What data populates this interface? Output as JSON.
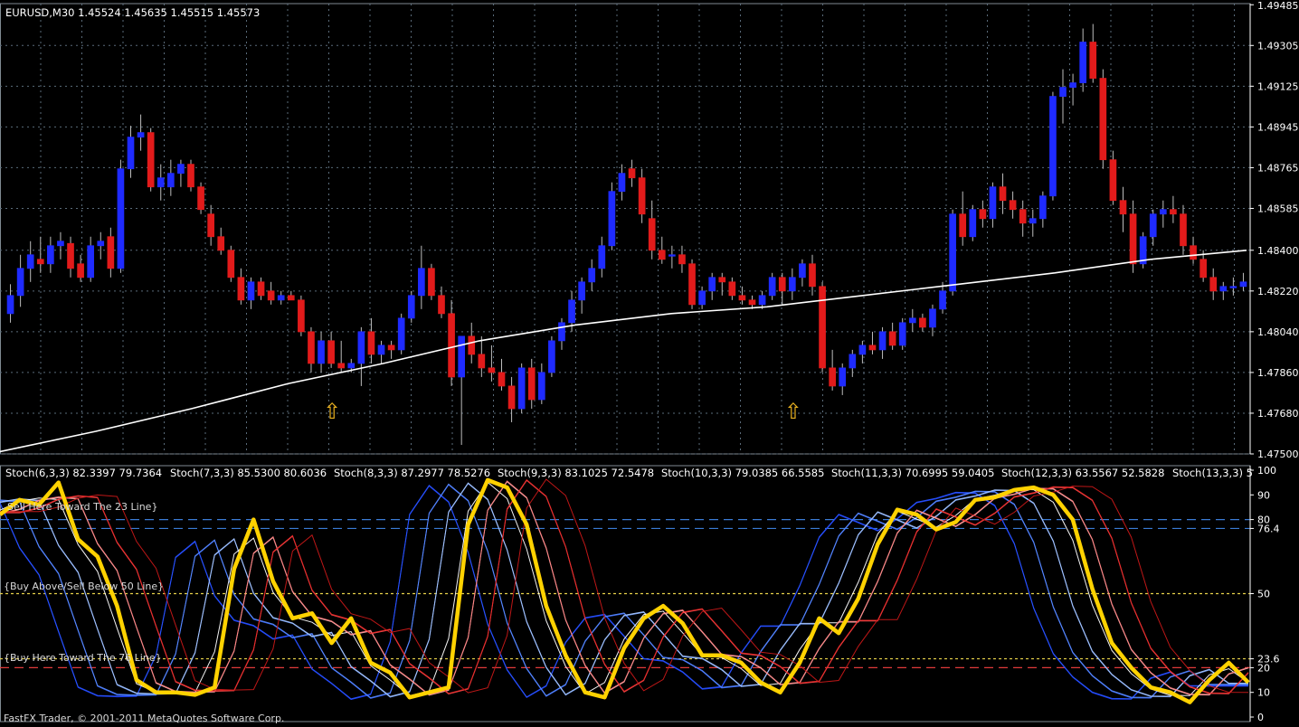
{
  "window": {
    "symbol_info": "EURUSD,M30  1.45524 1.45635 1.45515 1.45573",
    "footer": "FastFX Trader, © 2001-2011 MetaQuotes Software Corp."
  },
  "colors": {
    "background": "#000000",
    "grid": "#5a6b7a",
    "bull_candle": "#1f2bff",
    "bear_candle": "#e21b1b",
    "moving_average": "#ffffff",
    "stoch_highlight": "#ffd200",
    "level_blue": "#3a7bd5",
    "level_yellow": "#e8d24a",
    "level_red": "#e03a3a"
  },
  "price_panel": {
    "price_axis": [
      "1.49485",
      "1.49305",
      "1.49125",
      "1.48945",
      "1.48765",
      "1.48585",
      "1.48400",
      "1.48220",
      "1.48040",
      "1.47860",
      "1.47680",
      "1.47500"
    ],
    "arrows": [
      {
        "name": "buy-arrow",
        "bar_index": 32,
        "glyph": "⇧"
      },
      {
        "name": "buy-arrow",
        "bar_index": 78,
        "glyph": "⇧"
      }
    ]
  },
  "stoch_panel": {
    "legend": [
      "Stoch(6,3,3) 82.3397 79.7364",
      "Stoch(7,3,3) 85.5300 80.6036",
      "Stoch(8,3,3) 87.2977 78.5276",
      "Stoch(9,3,3) 83.1025 72.5478",
      "Stoch(10,3,3) 79.0385 66.5585",
      "Stoch(11,3,3) 70.6995 59.0405",
      "Stoch(12,3,3) 63.5567 52.5828",
      "Stoch(13,3,3) 5"
    ],
    "annotations": [
      {
        "text": "Sell Here Toward The 23 Line}",
        "level": 80
      },
      {
        "text": "{Buy Above/Sell Below 50 Line}",
        "level": 50
      },
      {
        "text": "{Buy Here Toward The 76 Line}",
        "level": 20
      }
    ],
    "levels": [
      {
        "value": 80,
        "color": "#3a7bd5"
      },
      {
        "value": 76.4,
        "color": "#3a7bd5"
      },
      {
        "value": 50,
        "color": "#e8d24a"
      },
      {
        "value": 23.6,
        "color": "#e8d24a"
      },
      {
        "value": 20,
        "color": "#e03a3a"
      }
    ],
    "axis_labels": [
      "100",
      "90",
      "80",
      "76.4",
      "50",
      "23.6",
      "20",
      "10",
      "0"
    ]
  },
  "chart_data": {
    "type": "candlestick",
    "title": "EURUSD,M30",
    "ylim": [
      1.475,
      1.4949
    ],
    "candles": [
      [
        1.4812,
        1.4825,
        1.4808,
        1.482
      ],
      [
        1.482,
        1.4838,
        1.4815,
        1.4832
      ],
      [
        1.4832,
        1.4844,
        1.4826,
        1.4838
      ],
      [
        1.4836,
        1.4846,
        1.483,
        1.4834
      ],
      [
        1.4834,
        1.4846,
        1.483,
        1.4842
      ],
      [
        1.4842,
        1.4848,
        1.4836,
        1.4844
      ],
      [
        1.4843,
        1.4846,
        1.4828,
        1.4832
      ],
      [
        1.4834,
        1.4838,
        1.4826,
        1.4828
      ],
      [
        1.4828,
        1.4846,
        1.4826,
        1.4842
      ],
      [
        1.4842,
        1.4848,
        1.4836,
        1.4844
      ],
      [
        1.4846,
        1.485,
        1.4828,
        1.4832
      ],
      [
        1.4832,
        1.488,
        1.483,
        1.4876
      ],
      [
        1.4876,
        1.4895,
        1.4872,
        1.489
      ],
      [
        1.489,
        1.49,
        1.4884,
        1.4892
      ],
      [
        1.4892,
        1.4894,
        1.4866,
        1.4868
      ],
      [
        1.4868,
        1.4878,
        1.4862,
        1.4872
      ],
      [
        1.4868,
        1.488,
        1.4864,
        1.4874
      ],
      [
        1.4874,
        1.488,
        1.4868,
        1.4878
      ],
      [
        1.4878,
        1.488,
        1.4866,
        1.4868
      ],
      [
        1.4868,
        1.487,
        1.4856,
        1.4858
      ],
      [
        1.4856,
        1.486,
        1.4842,
        1.4846
      ],
      [
        1.4846,
        1.485,
        1.4838,
        1.484
      ],
      [
        1.484,
        1.4842,
        1.4826,
        1.4828
      ],
      [
        1.4828,
        1.4832,
        1.4816,
        1.4818
      ],
      [
        1.4818,
        1.4828,
        1.4814,
        1.4826
      ],
      [
        1.4826,
        1.4828,
        1.4818,
        1.482
      ],
      [
        1.4822,
        1.4826,
        1.4816,
        1.4818
      ],
      [
        1.4818,
        1.4822,
        1.4816,
        1.482
      ],
      [
        1.482,
        1.4822,
        1.4818,
        1.4818
      ],
      [
        1.4818,
        1.482,
        1.4802,
        1.4804
      ],
      [
        1.4804,
        1.4806,
        1.4786,
        1.479
      ],
      [
        1.479,
        1.4804,
        1.4786,
        1.48
      ],
      [
        1.48,
        1.4804,
        1.4788,
        1.479
      ],
      [
        1.479,
        1.48,
        1.4786,
        1.4788
      ],
      [
        1.4788,
        1.4792,
        1.4786,
        1.479
      ],
      [
        1.479,
        1.4806,
        1.478,
        1.4804
      ],
      [
        1.4804,
        1.481,
        1.479,
        1.4794
      ],
      [
        1.4794,
        1.48,
        1.479,
        1.4798
      ],
      [
        1.4798,
        1.48,
        1.4792,
        1.4796
      ],
      [
        1.4796,
        1.4812,
        1.4794,
        1.481
      ],
      [
        1.481,
        1.4822,
        1.4808,
        1.482
      ],
      [
        1.482,
        1.4842,
        1.4814,
        1.4832
      ],
      [
        1.4832,
        1.4834,
        1.4818,
        1.482
      ],
      [
        1.482,
        1.4824,
        1.481,
        1.4812
      ],
      [
        1.4812,
        1.4818,
        1.478,
        1.4784
      ],
      [
        1.4784,
        1.48,
        1.4754,
        1.4802
      ],
      [
        1.4802,
        1.4808,
        1.479,
        1.4794
      ],
      [
        1.4794,
        1.4802,
        1.4784,
        1.4788
      ],
      [
        1.4788,
        1.4798,
        1.4782,
        1.4786
      ],
      [
        1.4786,
        1.4792,
        1.4778,
        1.478
      ],
      [
        1.478,
        1.4784,
        1.4764,
        1.477
      ],
      [
        1.477,
        1.479,
        1.4768,
        1.4788
      ],
      [
        1.4788,
        1.4792,
        1.477,
        1.4774
      ],
      [
        1.4774,
        1.479,
        1.4772,
        1.4786
      ],
      [
        1.4786,
        1.4802,
        1.4784,
        1.48
      ],
      [
        1.48,
        1.481,
        1.4796,
        1.4808
      ],
      [
        1.4808,
        1.4822,
        1.4804,
        1.4818
      ],
      [
        1.4818,
        1.4828,
        1.4812,
        1.4826
      ],
      [
        1.4826,
        1.4836,
        1.4822,
        1.4832
      ],
      [
        1.4832,
        1.4846,
        1.4828,
        1.4842
      ],
      [
        1.4842,
        1.487,
        1.484,
        1.4866
      ],
      [
        1.4866,
        1.4878,
        1.4862,
        1.4874
      ],
      [
        1.4876,
        1.488,
        1.4868,
        1.4872
      ],
      [
        1.4872,
        1.4876,
        1.4852,
        1.4856
      ],
      [
        1.4854,
        1.4862,
        1.4836,
        1.484
      ],
      [
        1.484,
        1.4846,
        1.4834,
        1.4836
      ],
      [
        1.4838,
        1.4842,
        1.4832,
        1.4838
      ],
      [
        1.4838,
        1.4842,
        1.483,
        1.4834
      ],
      [
        1.4834,
        1.4836,
        1.4814,
        1.4816
      ],
      [
        1.4816,
        1.4824,
        1.4814,
        1.4822
      ],
      [
        1.4822,
        1.483,
        1.4818,
        1.4828
      ],
      [
        1.4828,
        1.483,
        1.482,
        1.4826
      ],
      [
        1.4826,
        1.4828,
        1.4818,
        1.482
      ],
      [
        1.482,
        1.4824,
        1.4816,
        1.4818
      ],
      [
        1.4818,
        1.482,
        1.4814,
        1.4816
      ],
      [
        1.4816,
        1.4822,
        1.4814,
        1.482
      ],
      [
        1.482,
        1.483,
        1.4818,
        1.4828
      ],
      [
        1.4828,
        1.483,
        1.4816,
        1.4822
      ],
      [
        1.4822,
        1.4832,
        1.4818,
        1.4828
      ],
      [
        1.4828,
        1.4836,
        1.4824,
        1.4834
      ],
      [
        1.4834,
        1.4838,
        1.482,
        1.4824
      ],
      [
        1.4824,
        1.4826,
        1.4786,
        1.4788
      ],
      [
        1.4788,
        1.4796,
        1.4778,
        1.478
      ],
      [
        1.478,
        1.479,
        1.4776,
        1.4788
      ],
      [
        1.4788,
        1.4796,
        1.4784,
        1.4794
      ],
      [
        1.4794,
        1.48,
        1.479,
        1.4798
      ],
      [
        1.4798,
        1.4804,
        1.4794,
        1.4796
      ],
      [
        1.4796,
        1.4806,
        1.4792,
        1.4804
      ],
      [
        1.4804,
        1.4808,
        1.4796,
        1.4798
      ],
      [
        1.4798,
        1.481,
        1.4796,
        1.4808
      ],
      [
        1.4808,
        1.4814,
        1.4804,
        1.481
      ],
      [
        1.481,
        1.4812,
        1.4804,
        1.4806
      ],
      [
        1.4806,
        1.4816,
        1.4802,
        1.4814
      ],
      [
        1.4814,
        1.4826,
        1.4812,
        1.4822
      ],
      [
        1.4822,
        1.4858,
        1.482,
        1.4856
      ],
      [
        1.4856,
        1.4866,
        1.4842,
        1.4846
      ],
      [
        1.4846,
        1.486,
        1.4844,
        1.4858
      ],
      [
        1.4858,
        1.4862,
        1.485,
        1.4854
      ],
      [
        1.4854,
        1.487,
        1.485,
        1.4868
      ],
      [
        1.4868,
        1.4874,
        1.4856,
        1.4862
      ],
      [
        1.4862,
        1.4866,
        1.4854,
        1.4858
      ],
      [
        1.4858,
        1.4862,
        1.4846,
        1.4852
      ],
      [
        1.4852,
        1.4858,
        1.4846,
        1.4854
      ],
      [
        1.4854,
        1.4866,
        1.485,
        1.4864
      ],
      [
        1.4864,
        1.491,
        1.4862,
        1.4908
      ],
      [
        1.4908,
        1.492,
        1.4896,
        1.4912
      ],
      [
        1.4912,
        1.4918,
        1.4904,
        1.4914
      ],
      [
        1.4914,
        1.4938,
        1.491,
        1.4932
      ],
      [
        1.4932,
        1.494,
        1.4914,
        1.4916
      ],
      [
        1.4916,
        1.492,
        1.4876,
        1.488
      ],
      [
        1.488,
        1.4884,
        1.486,
        1.4862
      ],
      [
        1.4862,
        1.4868,
        1.4848,
        1.4856
      ],
      [
        1.4856,
        1.4862,
        1.483,
        1.4834
      ],
      [
        1.4834,
        1.4848,
        1.4832,
        1.4846
      ],
      [
        1.4846,
        1.4858,
        1.4842,
        1.4856
      ],
      [
        1.4856,
        1.4862,
        1.485,
        1.4858
      ],
      [
        1.4858,
        1.4864,
        1.4852,
        1.4856
      ],
      [
        1.4856,
        1.486,
        1.4838,
        1.4842
      ],
      [
        1.4842,
        1.4846,
        1.4834,
        1.4836
      ],
      [
        1.4836,
        1.484,
        1.4826,
        1.4828
      ],
      [
        1.4828,
        1.4832,
        1.4818,
        1.4822
      ],
      [
        1.4822,
        1.4826,
        1.4818,
        1.4824
      ],
      [
        1.4824,
        1.4828,
        1.482,
        1.4824
      ],
      [
        1.4824,
        1.483,
        1.4822,
        1.4826
      ]
    ],
    "moving_average": [
      1.4751,
      1.476,
      1.477,
      1.4781,
      1.479,
      1.48,
      1.4807,
      1.4812,
      1.4815,
      1.482,
      1.4825,
      1.483,
      1.4836,
      1.484
    ],
    "stochastic_main": [
      82,
      88,
      86,
      95,
      72,
      65,
      45,
      15,
      10,
      10,
      9,
      12,
      60,
      80,
      55,
      40,
      42,
      30,
      40,
      22,
      18,
      8,
      10,
      12,
      78,
      96,
      93,
      78,
      45,
      25,
      10,
      8,
      28,
      40,
      45,
      38,
      25,
      25,
      22,
      14,
      10,
      22,
      40,
      34,
      48,
      70,
      84,
      82,
      76,
      79,
      88,
      89,
      92,
      93,
      90,
      80,
      52,
      30,
      20,
      12,
      10,
      6,
      15,
      22,
      14
    ],
    "stochastic_levels": [
      100,
      90,
      80,
      76.4,
      50,
      23.6,
      20,
      10,
      0
    ]
  }
}
